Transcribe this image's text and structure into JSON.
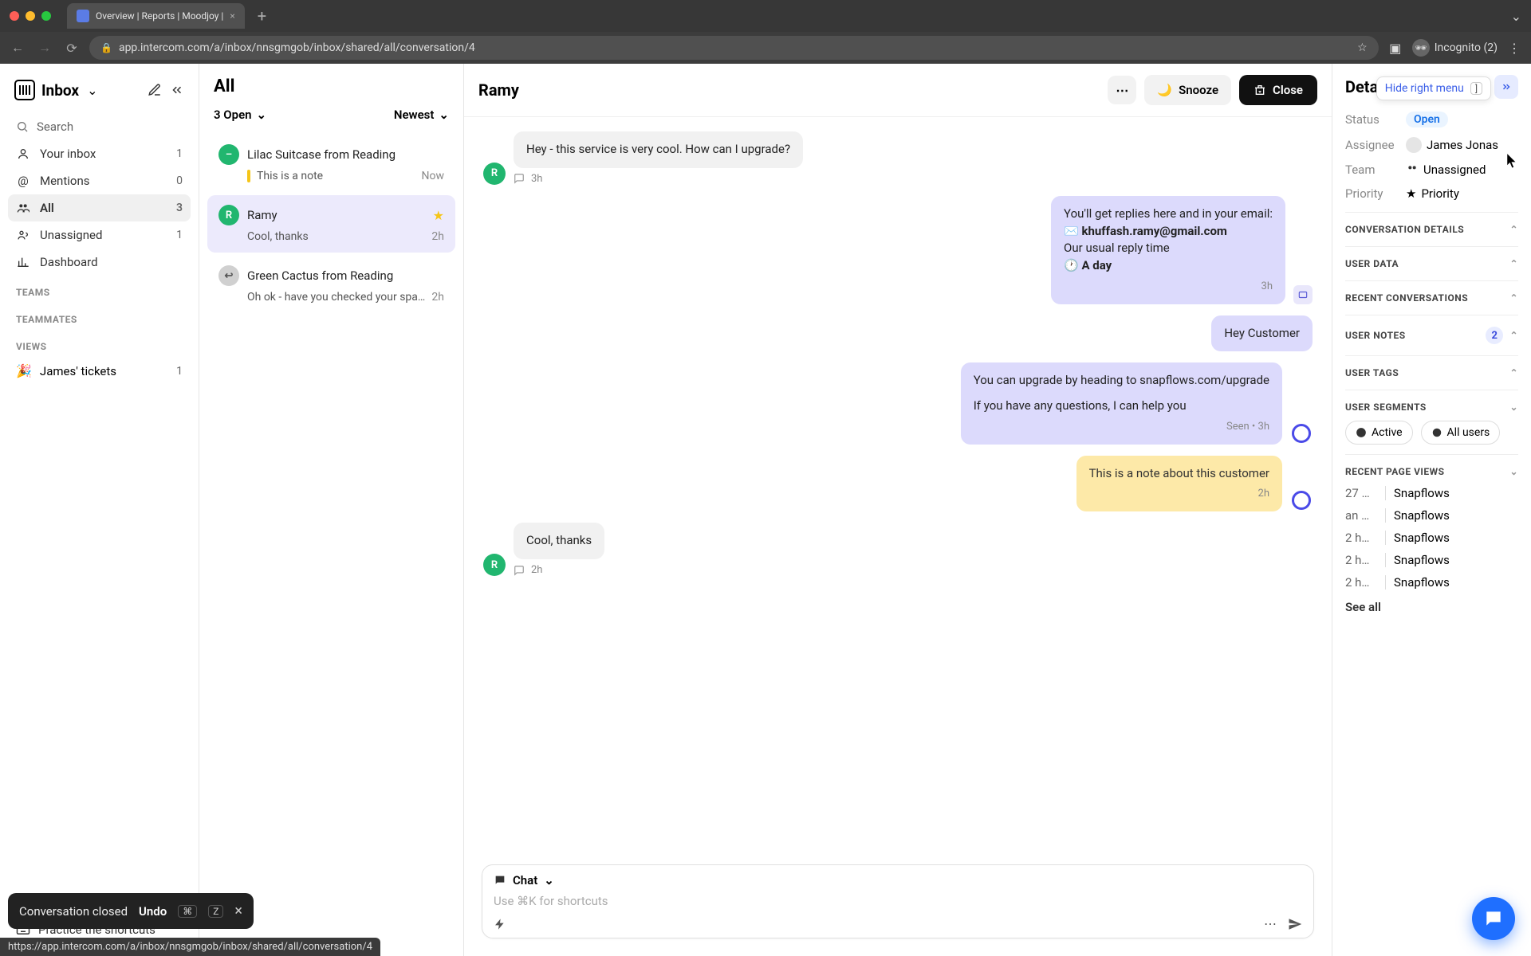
{
  "browser": {
    "tab_title": "Overview | Reports | Moodjoy |",
    "url": "app.intercom.com/a/inbox/nnsgmgob/inbox/shared/all/conversation/4",
    "incognito": "Incognito (2)"
  },
  "sidebar": {
    "title": "Inbox",
    "search": "Search",
    "items": [
      {
        "icon": "user",
        "label": "Your inbox",
        "count": "1"
      },
      {
        "icon": "at",
        "label": "Mentions",
        "count": "0"
      },
      {
        "icon": "people",
        "label": "All",
        "count": "3",
        "active": true
      },
      {
        "icon": "people",
        "label": "Unassigned",
        "count": "1"
      },
      {
        "icon": "bars",
        "label": "Dashboard",
        "count": ""
      }
    ],
    "section_teams": "TEAMS",
    "section_teammates": "TEAMMATES",
    "section_views": "VIEWS",
    "views": [
      {
        "emoji": "🎉",
        "label": "James' tickets",
        "count": "1"
      }
    ],
    "footer": "Practice the shortcuts"
  },
  "conv_list": {
    "title": "All",
    "filter_left": "3 Open",
    "filter_right": "Newest",
    "items": [
      {
        "avatar": "–",
        "av_class": "av-green",
        "name": "Lilac Suitcase from Reading",
        "preview": "This is a note",
        "time": "Now",
        "note": true
      },
      {
        "avatar": "R",
        "av_class": "av-green",
        "name": "Ramy",
        "preview": "Cool, thanks",
        "time": "2h",
        "selected": true,
        "star": true
      },
      {
        "avatar": "↩",
        "av_class": "av-grey",
        "name": "Green Cactus from Reading",
        "preview": "Oh ok - have you checked your spam?",
        "time": "2h"
      }
    ]
  },
  "conversation": {
    "name": "Ramy",
    "snooze": "Snooze",
    "close": "Close",
    "messages": {
      "m1_text": "Hey - this service is very cool. How can I upgrade?",
      "m1_time": "3h",
      "m2_line1": "You'll get replies here and in your email:",
      "m2_email": "khuffash.ramy@gmail.com",
      "m2_line2": "Our usual reply time",
      "m2_line3": "🕐 A day",
      "m2_time": "3h",
      "m3_text": "Hey Customer",
      "m4_line1": "You can upgrade by heading to snapflows.com/upgrade",
      "m4_line2": "If you have any questions, I can help you",
      "m4_meta": "Seen • 3h",
      "m5_text": "This is a note about this customer",
      "m5_time": "2h",
      "m6_text": "Cool, thanks",
      "m6_time": "2h"
    },
    "composer_mode": "Chat",
    "composer_placeholder": "Use ⌘K for shortcuts"
  },
  "details": {
    "title": "Details",
    "tooltip": "Hide right menu",
    "tooltip_key": "]",
    "status_label": "Status",
    "status_value": "Open",
    "assignee_label": "Assignee",
    "assignee_value": "James Jonas",
    "team_label": "Team",
    "team_value": "Unassigned",
    "priority_label": "Priority",
    "priority_value": "Priority",
    "sec_conv": "CONVERSATION DETAILS",
    "sec_user_data": "USER DATA",
    "sec_recent_conv": "RECENT CONVERSATIONS",
    "sec_user_notes": "USER NOTES",
    "notes_count": "2",
    "sec_user_tags": "USER TAGS",
    "sec_user_segments": "USER SEGMENTS",
    "segment_active": "Active",
    "segment_all": "All users",
    "sec_page_views": "RECENT PAGE VIEWS",
    "page_views": [
      {
        "t": "27 …",
        "p": "Snapflows"
      },
      {
        "t": "an …",
        "p": "Snapflows"
      },
      {
        "t": "2 h…",
        "p": "Snapflows"
      },
      {
        "t": "2 h…",
        "p": "Snapflows"
      },
      {
        "t": "2 h…",
        "p": "Snapflows"
      }
    ],
    "see_all": "See all"
  },
  "toast": {
    "msg": "Conversation closed",
    "undo": "Undo",
    "k1": "⌘",
    "k2": "Z"
  },
  "status_url": "https://app.intercom.com/a/inbox/nnsgmgob/inbox/shared/all/conversation/4"
}
